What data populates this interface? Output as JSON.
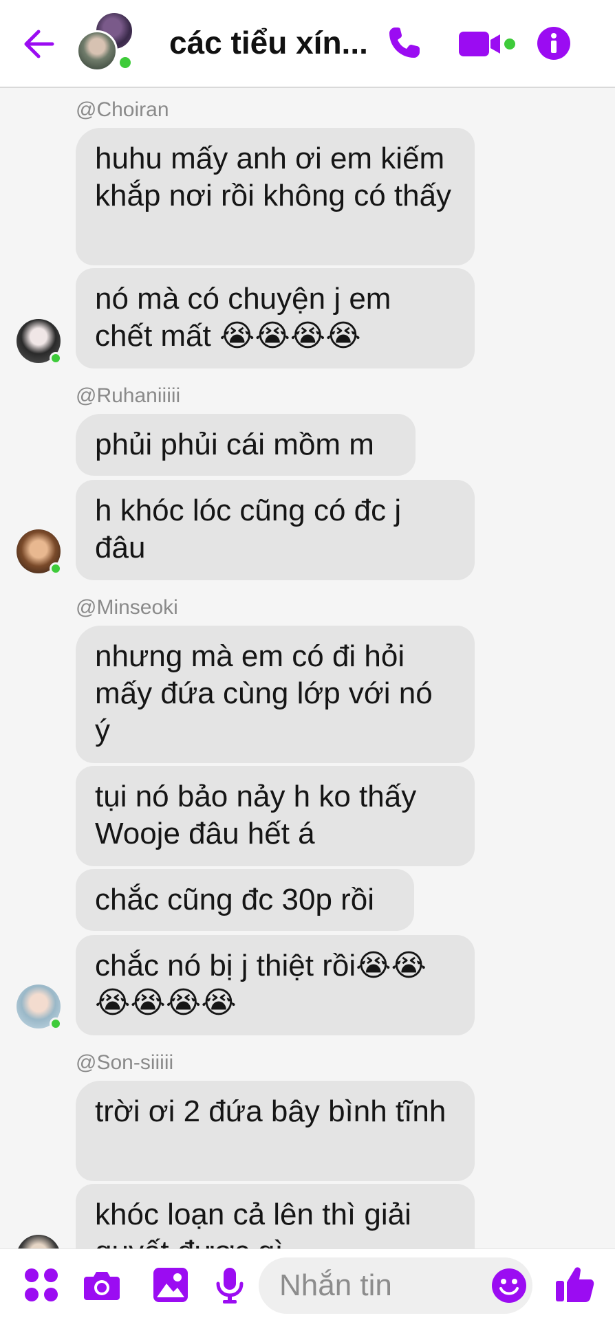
{
  "header": {
    "title": "các tiểu xín...",
    "accent_color": "#9b0cf2",
    "online_color": "#3ecb3a"
  },
  "messages": [
    {
      "sender": "@Choiran",
      "bubbles": [
        "huhu mấy anh ơi em kiếm khắp nơi rồi không có thấy",
        "nó mà có chuyện j em chết mất 😭😭😭😭"
      ]
    },
    {
      "sender": "@Ruhaniiiii",
      "bubbles": [
        "phủi phủi cái mồm m",
        "h khóc lóc cũng có đc j đâu"
      ]
    },
    {
      "sender": "@Minseoki",
      "bubbles": [
        "nhưng mà em có đi hỏi mấy đứa cùng lớp với nó ý",
        "tụi nó bảo nảy h ko thấy Wooje đâu hết á",
        "chắc cũng đc 30p rồi",
        "chắc nó bị j thiệt rồi😭😭😭😭😭😭"
      ]
    },
    {
      "sender": "@Son-siiiii",
      "bubbles": [
        "trời ơi 2 đứa bây bình tĩnh",
        "khóc loạn cả lên thì giải quyết được gì"
      ]
    }
  ],
  "composer": {
    "placeholder": "Nhắn tin"
  },
  "icons": [
    "back-arrow-icon",
    "phone-icon",
    "video-camera-icon",
    "info-icon",
    "apps-grid-icon",
    "camera-icon",
    "image-icon",
    "microphone-icon",
    "emoji-icon",
    "thumbs-up-icon"
  ]
}
